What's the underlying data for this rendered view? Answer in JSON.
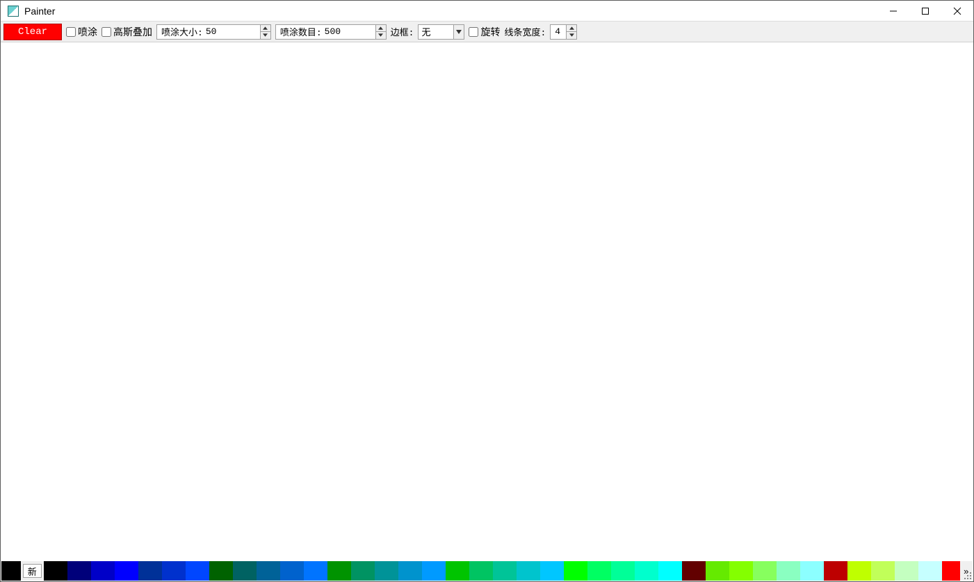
{
  "window": {
    "title": "Painter"
  },
  "toolbar": {
    "clear_label": "Clear",
    "spray_checkbox_label": "喷涂",
    "gaussian_checkbox_label": "高斯叠加",
    "spray_size": {
      "prefix": "喷涂大小:",
      "value": "50"
    },
    "spray_count": {
      "prefix": "喷涂数目:",
      "value": "500"
    },
    "border_label": "边框:",
    "border_value": "无",
    "rotate_checkbox_label": "旋转",
    "line_width_label": "线条宽度:",
    "line_width_value": "4"
  },
  "palette": {
    "current_color": "#000000",
    "new_button_label": "新",
    "overflow_symbol": "»",
    "swatches": [
      "#000000",
      "#00007a",
      "#0000c8",
      "#0000ff",
      "#003198",
      "#0031cd",
      "#0046ff",
      "#006200",
      "#006262",
      "#006298",
      "#0062cd",
      "#0074ff",
      "#009300",
      "#009362",
      "#009398",
      "#0093cd",
      "#009aff",
      "#00c400",
      "#00c462",
      "#00c498",
      "#00c4cd",
      "#00c6ff",
      "#00ff00",
      "#00ff62",
      "#00ff98",
      "#00ffcd",
      "#00ffff",
      "#620000",
      "#65ea00",
      "#84ff00",
      "#87ff5e",
      "#8affc1",
      "#8cffff",
      "#bd0000",
      "#bfff00",
      "#c1ff59",
      "#c4ffc0",
      "#c6ffff",
      "#ff0000",
      "#ff007c",
      "#ff00c3",
      "#ff00ff"
    ]
  }
}
